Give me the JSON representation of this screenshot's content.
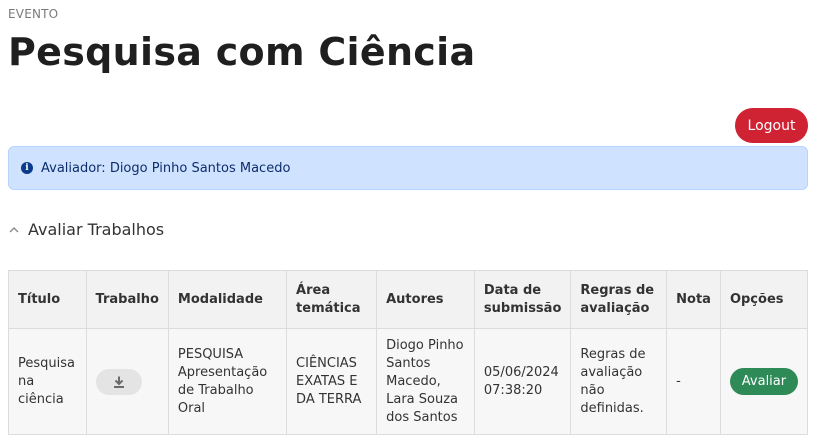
{
  "header": {
    "eyebrow": "EVENTO",
    "title": "Pesquisa com Ciência",
    "logout_label": "Logout"
  },
  "alert": {
    "text": "Avaliador: Diogo Pinho Santos Macedo",
    "icon": "info-icon"
  },
  "section": {
    "label": "Avaliar Trabalhos",
    "icon": "chevron-up-icon"
  },
  "table": {
    "columns": [
      "Título",
      "Trabalho",
      "Modalidade",
      "Área temática",
      "Autores",
      "Data de submissão",
      "Regras de avaliação",
      "Nota",
      "Opções"
    ],
    "rows": [
      {
        "titulo": "Pesquisa na ciência",
        "trabalho_icon": "download-icon",
        "modalidade": "PESQUISA Apresentação de Trabalho Oral",
        "area": "CIÊNCIAS EXATAS E DA TERRA",
        "autores": "Diogo Pinho Santos Macedo, Lara Souza dos Santos",
        "data": "05/06/2024 07:38:20",
        "regras": "Regras de avaliação não definidas.",
        "nota": "-",
        "acao_label": "Avaliar"
      }
    ]
  },
  "colors": {
    "logout": "#cf2233",
    "alert_bg": "#cfe2ff",
    "avaliar": "#2e8b57"
  }
}
